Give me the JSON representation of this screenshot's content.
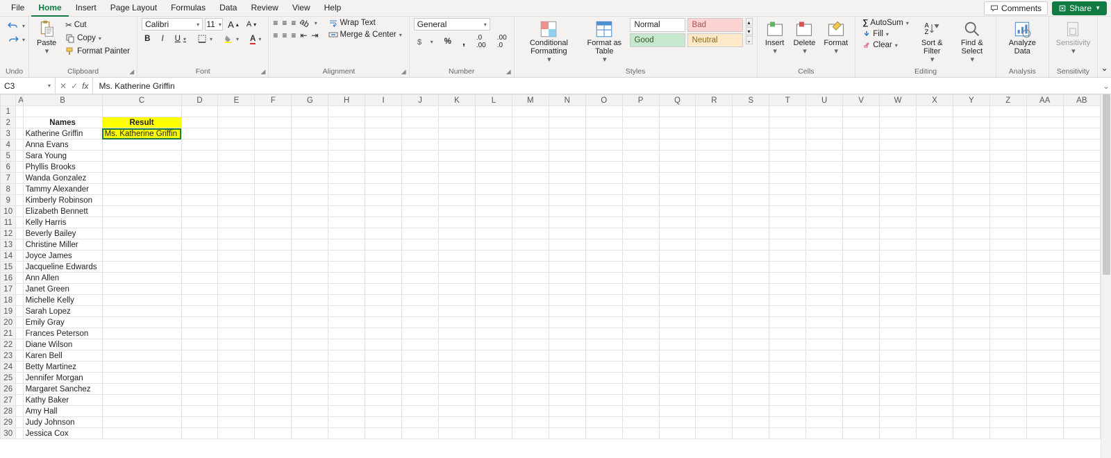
{
  "tabs": [
    "File",
    "Home",
    "Insert",
    "Page Layout",
    "Formulas",
    "Data",
    "Review",
    "View",
    "Help"
  ],
  "active_tab": "Home",
  "top": {
    "comments": "Comments",
    "share": "Share"
  },
  "ribbon": {
    "undo": "Undo",
    "paste": "Paste",
    "cut": "Cut",
    "copy": "Copy",
    "painter": "Format Painter",
    "clipboard": "Clipboard",
    "font_name": "Calibri",
    "font_size": "11",
    "font": "Font",
    "wrap": "Wrap Text",
    "merge": "Merge & Center",
    "alignment": "Alignment",
    "numfmt": "General",
    "number": "Number",
    "cond": "Conditional Formatting",
    "fmttable": "Format as Table",
    "styles_label": "Styles",
    "styles": {
      "normal": "Normal",
      "bad": "Bad",
      "good": "Good",
      "neutral": "Neutral"
    },
    "insert": "Insert",
    "delete": "Delete",
    "format": "Format",
    "cells": "Cells",
    "autosum": "AutoSum",
    "fill": "Fill",
    "clear": "Clear",
    "sort": "Sort & Filter",
    "find": "Find & Select",
    "editing": "Editing",
    "analyze": "Analyze Data",
    "analysis": "Analysis",
    "sensitivity": "Sensitivity",
    "sens_label": "Sensitivity"
  },
  "namebox": "C3",
  "formula": "Ms. Katherine Griffin",
  "columns": [
    "A",
    "B",
    "C",
    "D",
    "E",
    "F",
    "G",
    "H",
    "I",
    "J",
    "K",
    "L",
    "M",
    "N",
    "O",
    "P",
    "Q",
    "R",
    "S",
    "T",
    "U",
    "V",
    "W",
    "X",
    "Y",
    "Z",
    "AA",
    "AB"
  ],
  "headers": {
    "names": "Names",
    "result": "Result"
  },
  "c3": "Ms. Katherine Griffin",
  "names": [
    "Katherine Griffin",
    "Anna Evans",
    "Sara Young",
    "Phyllis Brooks",
    "Wanda Gonzalez",
    "Tammy Alexander",
    "Kimberly Robinson",
    "Elizabeth Bennett",
    "Kelly Harris",
    "Beverly Bailey",
    "Christine Miller",
    "Joyce James",
    "Jacqueline Edwards",
    "Ann Allen",
    "Janet Green",
    "Michelle Kelly",
    "Sarah Lopez",
    "Emily Gray",
    "Frances Peterson",
    "Diane Wilson",
    "Karen Bell",
    "Betty Martinez",
    "Jennifer Morgan",
    "Margaret Sanchez",
    "Kathy Baker",
    "Amy Hall",
    "Judy Johnson",
    "Jessica Cox"
  ]
}
